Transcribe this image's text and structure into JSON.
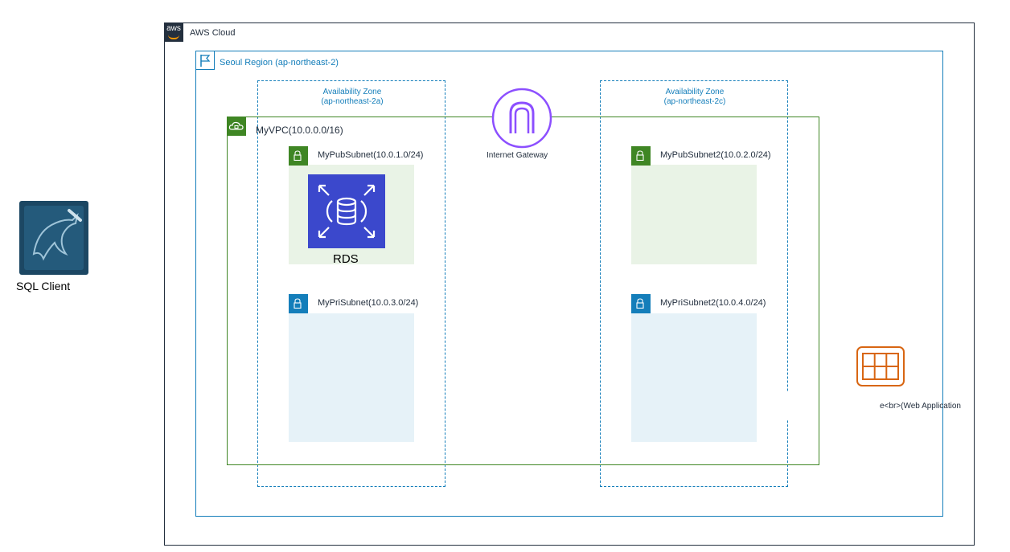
{
  "cloud": {
    "label": "AWS Cloud",
    "logo_text": "aws"
  },
  "region": {
    "label": "Seoul Region (ap-northeast-2)"
  },
  "az_a": {
    "line1": "Availability Zone",
    "line2": "(ap-northeast-2a)"
  },
  "az_c": {
    "line1": "Availability Zone",
    "line2": "(ap-northeast-2c)"
  },
  "vpc": {
    "label": "MyVPC(10.0.0.0/16)"
  },
  "subnets": {
    "pub1": "MyPubSubnet(10.0.1.0/24)",
    "pub2": "MyPubSubnet2(10.0.2.0/24)",
    "pri1": "MyPriSubnet(10.0.3.0/24)",
    "pri2": "MyPriSubnet2(10.0.4.0/24)"
  },
  "igw": {
    "label": "Internet Gateway"
  },
  "rds": {
    "label": "RDS"
  },
  "sql_client": {
    "label": "SQL Client"
  },
  "web_app": {
    "label": "e<br>(Web Application"
  },
  "colors": {
    "cloud_border": "#232f3e",
    "region": "#147eba",
    "vpc": "#3f8624",
    "public_fill": "#e9f3e6",
    "private_fill": "#e6f2f8",
    "igw": "#8c4fff",
    "rds": "#3b48cc",
    "web_app": "#d86613"
  },
  "icons": {
    "cloud": "aws-logo-icon",
    "region": "flag-icon",
    "vpc": "cloud-lock-icon",
    "subnet": "padlock-icon",
    "igw": "internet-gateway-icon",
    "rds": "rds-database-icon",
    "sql_client": "mysql-dolphin-icon",
    "web_app": "group-grid-icon"
  }
}
